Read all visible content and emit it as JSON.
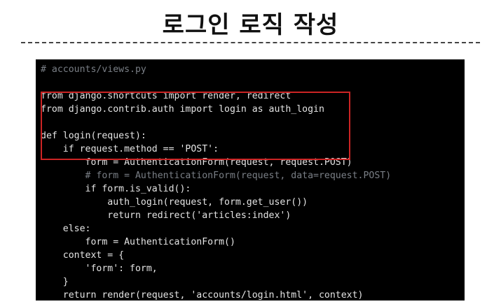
{
  "slide": {
    "title": "로그인 로직 작성"
  },
  "code": {
    "lines": [
      "# accounts/views.py",
      "",
      "from django.shortcuts import render, redirect",
      "from django.contrib.auth import login as auth_login",
      "",
      "def login(request):",
      "    if request.method == 'POST':",
      "        form = AuthenticationForm(request, request.POST)",
      "        # form = AuthenticationForm(request, data=request.POST)",
      "        if form.is_valid():",
      "            auth_login(request, form.get_user())",
      "            return redirect('articles:index')",
      "    else:",
      "        form = AuthenticationForm()",
      "    context = {",
      "        'form': form,",
      "    }",
      "    return render(request, 'accounts/login.html', context)"
    ]
  },
  "colors": {
    "highlight_box": "#cc2424",
    "code_background": "#000000"
  }
}
